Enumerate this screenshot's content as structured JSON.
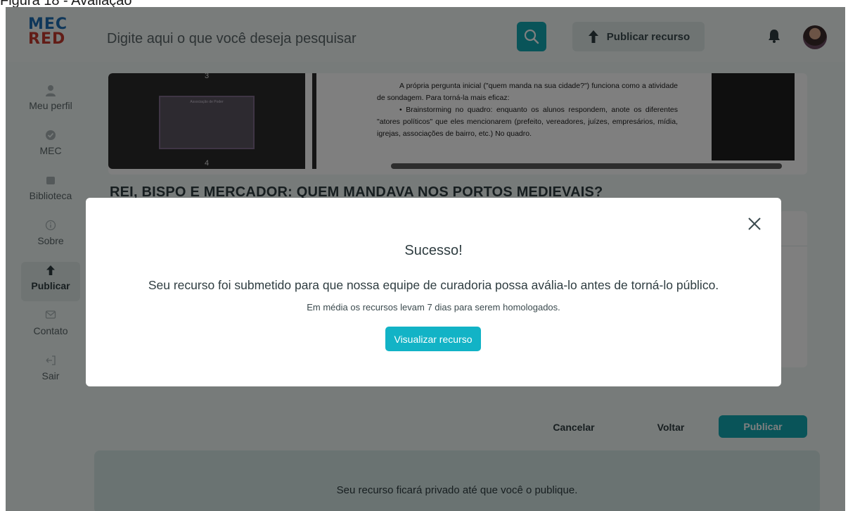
{
  "caption": "Figura 18 - Avaliação",
  "brand": {
    "line1": "MEC",
    "line2": "RED",
    "color_primary": "#1e6fb5",
    "color_secondary": "#c43a2e"
  },
  "header": {
    "search_placeholder": "Digite aqui o que você deseja pesquisar",
    "publish_label": "Publicar recurso",
    "accent": "#12a8b3"
  },
  "sidebar": {
    "items": [
      {
        "label": "Meu perfil",
        "icon": "user-icon"
      },
      {
        "label": "MEC",
        "icon": "check-badge-icon"
      },
      {
        "label": "Biblioteca",
        "icon": "library-icon"
      },
      {
        "label": "Sobre",
        "icon": "info-icon"
      },
      {
        "label": "Publicar",
        "icon": "upload-arrow-icon",
        "active": true
      },
      {
        "label": "Contato",
        "icon": "mail-icon"
      },
      {
        "label": "Sair",
        "icon": "logout-icon"
      }
    ]
  },
  "preview": {
    "slide_numbers": [
      "3",
      "4"
    ],
    "slide_title": "Associação de Poder",
    "doc_paragraphs": [
      "A própria pergunta inicial (\"quem manda na sua cidade?\") funciona como a atividade de sondagem. Para torná-la mais eficaz:",
      "•        Brainstorming no quadro: enquanto os alunos respondem, anote os diferentes \"atores políticos\" que eles mencionarem (prefeito, vereadores, juízes, empresários, mídia, igrejas, associações de bairro, etc.) No quadro."
    ]
  },
  "resource_title": "REI, BISPO E MERCADOR: QUEM MANDAVA NOS PORTOS MEDIEVAIS?",
  "actions": {
    "cancel": "Cancelar",
    "back": "Voltar",
    "publish": "Publicar"
  },
  "private_notice": "Seu recurso ficará privado até que você o publique.",
  "modal": {
    "title": "Sucesso!",
    "message": "Seu recurso foi submetido para que nossa equipe de curadoria possa avália-lo antes de torná-lo público.",
    "sub": "Em média os recursos levam 7 dias para serem homologados.",
    "button": "Visualizar recurso"
  }
}
